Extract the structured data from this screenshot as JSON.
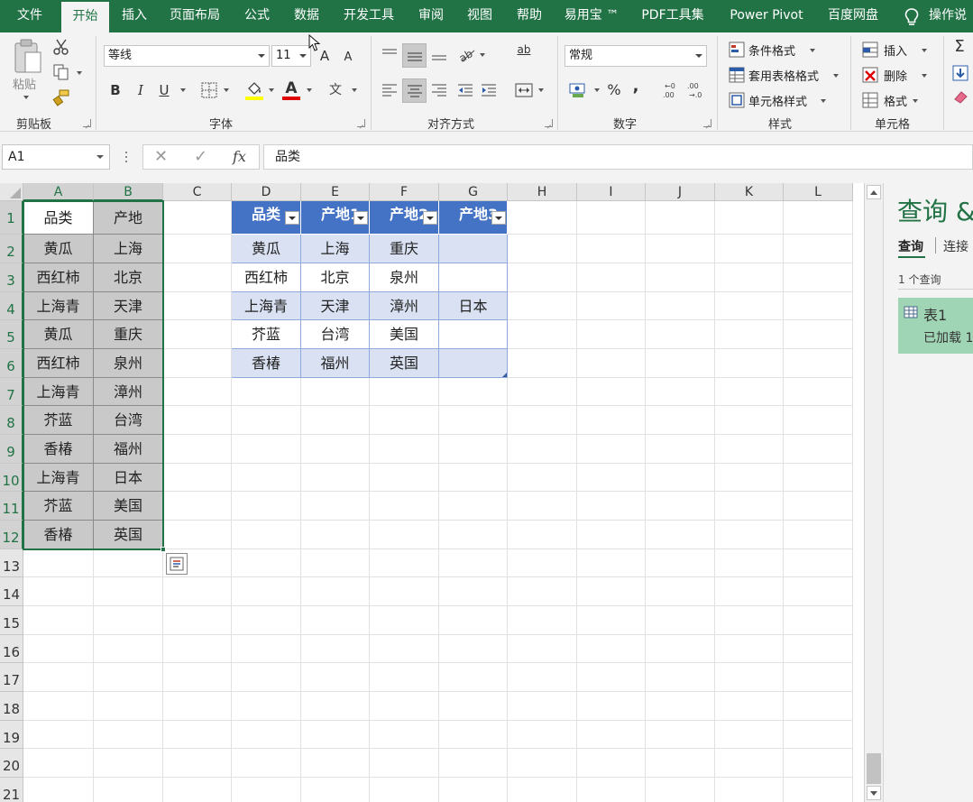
{
  "ribbon_tabs": [
    "文件",
    "开始",
    "插入",
    "页面布局",
    "公式",
    "数据",
    "开发工具",
    "审阅",
    "视图",
    "帮助",
    "易用宝 ™",
    "PDF工具集",
    "Power Pivot",
    "百度网盘",
    "操作说"
  ],
  "active_tab": "开始",
  "ribbon": {
    "paste_label": "粘贴",
    "clipboard_label": "剪贴板",
    "font_name": "等线",
    "font_size": "11",
    "grow_font": "A",
    "shrink_font": "A",
    "bold": "B",
    "italic": "I",
    "underline": "U",
    "font_color_glyph": "A",
    "phonetic_glyph": "文",
    "font_label": "字体",
    "wrap_glyph": "ab",
    "align_label": "对齐方式",
    "number_format": "常规",
    "percent": "%",
    "comma": ",",
    "number_label": "数字",
    "cond_format": "条件格式",
    "table_format": "套用表格格式",
    "cell_styles": "单元格样式",
    "styles_label": "样式",
    "insert": "插入",
    "delete": "删除",
    "format": "格式",
    "cells_label": "单元格",
    "sum_glyph": "Σ"
  },
  "formula_bar": {
    "name_box": "A1",
    "cancel": "✕",
    "enter": "✓",
    "fx": "fx",
    "content": "品类"
  },
  "columns": [
    "A",
    "B",
    "C",
    "D",
    "E",
    "F",
    "G",
    "H",
    "I",
    "J",
    "K",
    "L"
  ],
  "rows": [
    "1",
    "2",
    "3",
    "4",
    "5",
    "6",
    "7",
    "8",
    "9",
    "10",
    "11",
    "12",
    "13",
    "14",
    "15",
    "16",
    "17",
    "18",
    "19",
    "20",
    "21"
  ],
  "source_table": {
    "header": [
      "品类",
      "产地"
    ],
    "rows": [
      [
        "黄瓜",
        "上海"
      ],
      [
        "西红柿",
        "北京"
      ],
      [
        "上海青",
        "天津"
      ],
      [
        "黄瓜",
        "重庆"
      ],
      [
        "西红柿",
        "泉州"
      ],
      [
        "上海青",
        "漳州"
      ],
      [
        "芥蓝",
        "台湾"
      ],
      [
        "香椿",
        "福州"
      ],
      [
        "上海青",
        "日本"
      ],
      [
        "芥蓝",
        "美国"
      ],
      [
        "香椿",
        "英国"
      ]
    ]
  },
  "result_table": {
    "header": [
      "品类",
      "产地1",
      "产地2",
      "产地3"
    ],
    "rows": [
      [
        "黄瓜",
        "上海",
        "重庆",
        ""
      ],
      [
        "西红柿",
        "北京",
        "泉州",
        ""
      ],
      [
        "上海青",
        "天津",
        "漳州",
        "日本"
      ],
      [
        "芥蓝",
        "台湾",
        "美国",
        ""
      ],
      [
        "香椿",
        "福州",
        "英国",
        ""
      ]
    ]
  },
  "query_pane": {
    "title": "查询 &",
    "tab_queries": "查询",
    "tab_connections": "连接",
    "count": "1 个查询",
    "query_name": "表1",
    "query_status": "已加载 1"
  },
  "colors": {
    "excel_green": "#217346",
    "table_header": "#4472c4",
    "table_band": "#d9e1f2",
    "source_fill": "#c9c9c9",
    "query_card": "#9fd5b5"
  }
}
